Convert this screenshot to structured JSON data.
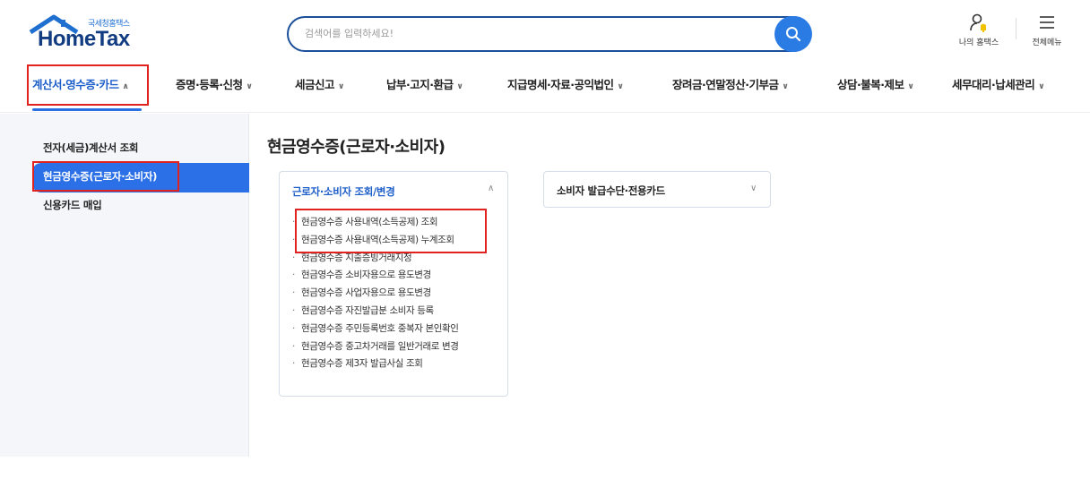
{
  "header": {
    "logo_sub": "국세청홈택스",
    "logo_main": "HomeTax",
    "search_placeholder": "검색어를 입력하세요!",
    "my_hometax": "나의 홈택스",
    "all_menu": "전체메뉴"
  },
  "gnb": {
    "items": [
      {
        "label": "계산서·영수증·카드",
        "chev": "∧"
      },
      {
        "label": "증명·등록·신청",
        "chev": "∨"
      },
      {
        "label": "세금신고",
        "chev": "∨"
      },
      {
        "label": "납부·고지·환급",
        "chev": "∨"
      },
      {
        "label": "지급명세·자료·공익법인",
        "chev": "∨"
      },
      {
        "label": "장려금·연말정산·기부금",
        "chev": "∨"
      },
      {
        "label": "상담·불복·제보",
        "chev": "∨"
      },
      {
        "label": "세무대리·납세관리",
        "chev": "∨"
      }
    ]
  },
  "sidebar": {
    "items": [
      {
        "label": "전자(세금)계산서 조회"
      },
      {
        "label": "현금영수증(근로자·소비자)"
      },
      {
        "label": "신용카드 매입"
      }
    ]
  },
  "main": {
    "title": "현금영수증(근로자·소비자)",
    "panel1": {
      "title": "근로자·소비자 조회/변경",
      "chev": "∧",
      "bullet": "·",
      "items": [
        "현금영수증 사용내역(소득공제) 조회",
        "현금영수증 사용내역(소득공제) 누계조회",
        "현금영수증 지출증빙거래지정",
        "현금영수증 소비자용으로 용도변경",
        "현금영수증 사업자용으로 용도변경",
        "현금영수증 자진발급분 소비자 등록",
        "현금영수증 주민등록번호 중복자 본인확인",
        "현금영수증 중고차거래를 일반거래로 변경",
        "현금영수증 제3자 발급사실 조회"
      ]
    },
    "panel2": {
      "title": "소비자 발급수단·전용카드",
      "chev": "∨"
    }
  },
  "colors": {
    "brand_blue": "#2b70e6",
    "navy": "#123c82",
    "highlight_red": "#e0231f"
  }
}
